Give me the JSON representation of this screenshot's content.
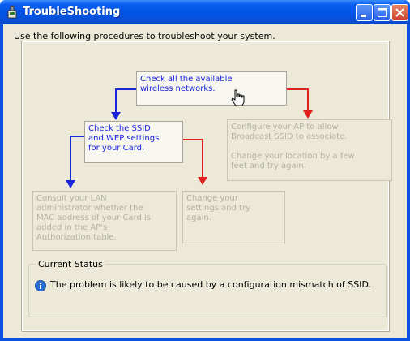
{
  "window": {
    "title": "TroubleShooting",
    "icon": "network-adapter-icon"
  },
  "caption_buttons": {
    "minimize": "minimize-icon",
    "maximize": "maximize-icon",
    "close": "close-icon"
  },
  "instruction": "Use the following procedures to troubleshoot your system.",
  "steps": {
    "check_networks": "Check all the available\nwireless networks.",
    "check_ssid": "Check the SSID\nand WEP settings\nfor your Card.",
    "configure_ap": "Configure your AP to allow\nBroadcast SSID to associate.\n\nChange your location by a few\nfeet and try again.",
    "consult_admin": "Consult your LAN\nadministrator whether the\nMAC address of your Card is\nadded in the AP's\nAuthorization table.",
    "change_settings": "Change your\nsettings and try\nagain."
  },
  "status": {
    "legend": "Current Status",
    "icon": "info-icon",
    "message": "The problem is likely to be caused by a configuration mismatch of SSID."
  },
  "colors": {
    "active_text": "#1a24dc",
    "inactive_text": "#b5b2a2",
    "arrow_blue": "#1a24dc",
    "arrow_red": "#e0201c",
    "titlebar": "#0055e5",
    "dialog_bg": "#ece9d8"
  }
}
